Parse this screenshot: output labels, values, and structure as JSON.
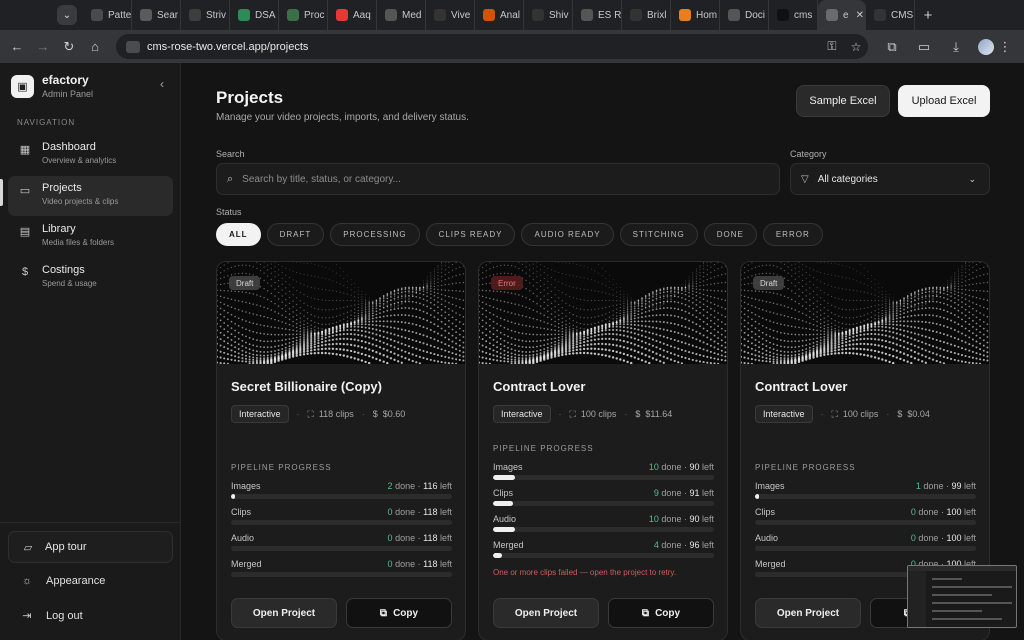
{
  "browser": {
    "tabs": [
      {
        "label": "Patte",
        "color": "#4a4a4a"
      },
      {
        "label": "Sear",
        "color": "#5b5b5b"
      },
      {
        "label": "Striv",
        "color": "#3d3d3d"
      },
      {
        "label": "DSA",
        "color": "#2e8b57"
      },
      {
        "label": "Proc",
        "color": "#3c6e47"
      },
      {
        "label": "Aaq",
        "color": "#e53935"
      },
      {
        "label": "Med",
        "color": "#555555"
      },
      {
        "label": "Vive",
        "color": "#333333"
      },
      {
        "label": "Anal",
        "color": "#d35400"
      },
      {
        "label": "Shiv",
        "color": "#333333"
      },
      {
        "label": "ES R",
        "color": "#555555"
      },
      {
        "label": "Brixl",
        "color": "#333333"
      },
      {
        "label": "Hom",
        "color": "#e67e22"
      },
      {
        "label": "Doci",
        "color": "#555555"
      },
      {
        "label": "cms",
        "color": "#111111"
      },
      {
        "label": "e",
        "color": "#6b6b6b"
      },
      {
        "label": "CMS",
        "color": "#333333"
      }
    ],
    "url": "cms-rose-two.vercel.app/projects"
  },
  "sidebar": {
    "brand_name": "efactory",
    "brand_sub": "Admin Panel",
    "nav_heading": "NAVIGATION",
    "items": [
      {
        "title": "Dashboard",
        "sub": "Overview & analytics",
        "icon": "grid-icon"
      },
      {
        "title": "Projects",
        "sub": "Video projects & clips",
        "icon": "folder-icon"
      },
      {
        "title": "Library",
        "sub": "Media files & folders",
        "icon": "library-icon"
      },
      {
        "title": "Costings",
        "sub": "Spend & usage",
        "icon": "dollar-icon"
      }
    ],
    "app_tour": "App tour",
    "appearance": "Appearance",
    "logout": "Log out"
  },
  "header": {
    "title": "Projects",
    "subtitle": "Manage your video projects, imports, and delivery status.",
    "sample_btn": "Sample Excel",
    "upload_btn": "Upload Excel"
  },
  "filters": {
    "search_label": "Search",
    "search_placeholder": "Search by title, status, or category...",
    "category_label": "Category",
    "category_value": "All categories",
    "status_label": "Status",
    "statuses": [
      "ALL",
      "DRAFT",
      "PROCESSING",
      "CLIPS READY",
      "AUDIO READY",
      "STITCHING",
      "DONE",
      "ERROR"
    ]
  },
  "cards": [
    {
      "badge": "Draft",
      "title": "Secret Billionaire (Copy)",
      "tag": "Interactive",
      "clips": "118 clips",
      "cost": "$0.60",
      "pipeline_heading": "PIPELINE PROGRESS",
      "stages": [
        {
          "name": "Images",
          "done": "2",
          "left": "116",
          "pct": 1.7
        },
        {
          "name": "Clips",
          "done": "0",
          "left": "118",
          "pct": 0
        },
        {
          "name": "Audio",
          "done": "0",
          "left": "118",
          "pct": 0
        },
        {
          "name": "Merged",
          "done": "0",
          "left": "118",
          "pct": 0
        }
      ],
      "error": "",
      "open": "Open Project",
      "copy": "Copy"
    },
    {
      "badge": "Error",
      "title": "Contract Lover",
      "tag": "Interactive",
      "clips": "100 clips",
      "cost": "$11.64",
      "pipeline_heading": "PIPELINE PROGRESS",
      "stages": [
        {
          "name": "Images",
          "done": "10",
          "left": "90",
          "pct": 10
        },
        {
          "name": "Clips",
          "done": "9",
          "left": "91",
          "pct": 9
        },
        {
          "name": "Audio",
          "done": "10",
          "left": "90",
          "pct": 10
        },
        {
          "name": "Merged",
          "done": "4",
          "left": "96",
          "pct": 4
        }
      ],
      "error": "One or more clips failed — open the project to retry.",
      "open": "Open Project",
      "copy": "Copy"
    },
    {
      "badge": "Draft",
      "title": "Contract Lover",
      "tag": "Interactive",
      "clips": "100 clips",
      "cost": "$0.04",
      "pipeline_heading": "PIPELINE PROGRESS",
      "stages": [
        {
          "name": "Images",
          "done": "1",
          "left": "99",
          "pct": 1
        },
        {
          "name": "Clips",
          "done": "0",
          "left": "100",
          "pct": 0
        },
        {
          "name": "Audio",
          "done": "0",
          "left": "100",
          "pct": 0
        },
        {
          "name": "Merged",
          "done": "0",
          "left": "100",
          "pct": 0
        }
      ],
      "error": "",
      "open": "Open Project",
      "copy": "Copy"
    }
  ],
  "labels": {
    "done": "done",
    "left": "left"
  },
  "colors": {
    "accent": "#f2f2f2",
    "done_green": "#4cc38a",
    "error_red": "#d05c5c",
    "background": "#141414"
  }
}
